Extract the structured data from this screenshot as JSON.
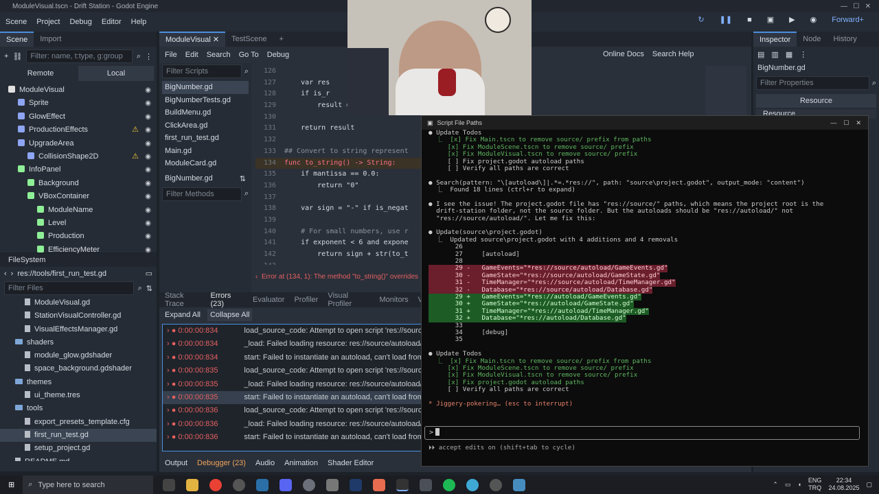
{
  "window_title": "ModuleVisual.tscn - Drift Station - Godot Engine",
  "menu": [
    "Scene",
    "Project",
    "Debug",
    "Editor",
    "Help"
  ],
  "renderer": "Forward+",
  "scene_panel": {
    "tabs": [
      "Scene",
      "Import"
    ],
    "filter_placeholder": "Filter: name, t:type, g:group",
    "remote": "Remote",
    "local": "Local",
    "nodes": [
      {
        "label": "ModuleVisual",
        "depth": 0,
        "color": "#e0e0e0",
        "warn": false
      },
      {
        "label": "Sprite",
        "depth": 1,
        "color": "#8da5f3",
        "warn": false
      },
      {
        "label": "GlowEffect",
        "depth": 1,
        "color": "#8da5f3",
        "warn": false
      },
      {
        "label": "ProductionEffects",
        "depth": 1,
        "color": "#8da5f3",
        "warn": true
      },
      {
        "label": "UpgradeArea",
        "depth": 1,
        "color": "#8da5f3",
        "warn": false
      },
      {
        "label": "CollisionShape2D",
        "depth": 2,
        "color": "#8da5f3",
        "warn": true
      },
      {
        "label": "InfoPanel",
        "depth": 1,
        "color": "#8eef97",
        "warn": false
      },
      {
        "label": "Background",
        "depth": 2,
        "color": "#8eef97",
        "warn": false
      },
      {
        "label": "VBoxContainer",
        "depth": 2,
        "color": "#8eef97",
        "warn": false
      },
      {
        "label": "ModuleName",
        "depth": 3,
        "color": "#8eef97",
        "warn": false
      },
      {
        "label": "Level",
        "depth": 3,
        "color": "#8eef97",
        "warn": false
      },
      {
        "label": "Production",
        "depth": 3,
        "color": "#8eef97",
        "warn": false
      },
      {
        "label": "EfficiencyMeter",
        "depth": 3,
        "color": "#8eef97",
        "warn": false
      }
    ]
  },
  "filesystem": {
    "title": "FileSystem",
    "path": "res://tools/first_run_test.gd",
    "filter_placeholder": "Filter Files",
    "items": [
      {
        "label": "ModuleVisual.gd",
        "depth": 2,
        "type": "file"
      },
      {
        "label": "StationVisualController.gd",
        "depth": 2,
        "type": "file"
      },
      {
        "label": "VisualEffectsManager.gd",
        "depth": 2,
        "type": "file"
      },
      {
        "label": "shaders",
        "depth": 1,
        "type": "folder"
      },
      {
        "label": "module_glow.gdshader",
        "depth": 2,
        "type": "file"
      },
      {
        "label": "space_background.gdshader",
        "depth": 2,
        "type": "file"
      },
      {
        "label": "themes",
        "depth": 1,
        "type": "folder"
      },
      {
        "label": "ui_theme.tres",
        "depth": 2,
        "type": "file"
      },
      {
        "label": "tools",
        "depth": 1,
        "type": "folder"
      },
      {
        "label": "export_presets_template.cfg",
        "depth": 2,
        "type": "file"
      },
      {
        "label": "first_run_test.gd",
        "depth": 2,
        "type": "file",
        "selected": true
      },
      {
        "label": "setup_project.gd",
        "depth": 2,
        "type": "file"
      },
      {
        "label": "README.md",
        "depth": 1,
        "type": "file"
      }
    ]
  },
  "editor_tabs": [
    "ModuleVisual",
    "TestScene"
  ],
  "script_menu": [
    "File",
    "Edit",
    "Search",
    "Go To",
    "Debug"
  ],
  "online_docs": "Online Docs",
  "search_help": "Search Help",
  "script_list": {
    "filter_placeholder": "Filter Scripts",
    "items": [
      "BigNumber.gd",
      "BigNumberTests.gd",
      "BuildMenu.gd",
      "ClickArea.gd",
      "first_run_test.gd",
      "Main.gd",
      "ModuleCard.gd"
    ],
    "current": "BigNumber.gd",
    "methods_placeholder": "Filter Methods"
  },
  "code": {
    "lines": [
      {
        "n": "126",
        "t": ""
      },
      {
        "n": "127",
        "t": "    var res"
      },
      {
        "n": "128",
        "t": "    if is_r"
      },
      {
        "n": "129",
        "t": "        result = -result"
      },
      {
        "n": "130",
        "t": ""
      },
      {
        "n": "131",
        "t": "    return result"
      },
      {
        "n": "132",
        "t": ""
      },
      {
        "n": "133",
        "t": "## Convert to string represent"
      },
      {
        "n": "134",
        "t": "func to_string() -> String:"
      },
      {
        "n": "135",
        "t": "    if mantissa == 0.0:"
      },
      {
        "n": "136",
        "t": "        return \"0\""
      },
      {
        "n": "137",
        "t": ""
      },
      {
        "n": "138",
        "t": "    var sign = \"-\" if is_negat"
      },
      {
        "n": "139",
        "t": ""
      },
      {
        "n": "140",
        "t": "    # For small numbers, use r"
      },
      {
        "n": "141",
        "t": "    if exponent < 6 and expone"
      },
      {
        "n": "142",
        "t": "        return sign + str(to_t"
      },
      {
        "n": "143",
        "t": ""
      }
    ],
    "error_line": "Error at (134, 1): The method \"to_string()\" overrides"
  },
  "debugger": {
    "tabs": [
      "Stack Trace",
      "Errors (23)",
      "Evaluator",
      "Profiler",
      "Visual Profiler",
      "Monitors",
      "V"
    ],
    "expand_all": "Expand All",
    "collapse_all": "Collapse All",
    "errors": [
      {
        "time": "0:00:00:834",
        "msg": "load_source_code: Attempt to open script 'res://source/autoloa"
      },
      {
        "time": "0:00:00:834",
        "msg": "_load: Failed loading resource: res://source/autoload/GameSta"
      },
      {
        "time": "0:00:00:834",
        "msg": "start: Failed to instantiate an autoload, can't load from path: re"
      },
      {
        "time": "0:00:00:835",
        "msg": "load_source_code: Attempt to open script 'res://source/autoloa"
      },
      {
        "time": "0:00:00:835",
        "msg": "_load: Failed loading resource: res://source/autoload/TimeMan"
      },
      {
        "time": "0:00:00:835",
        "msg": "start: Failed to instantiate an autoload, can't load from path: re"
      },
      {
        "time": "0:00:00:836",
        "msg": "load_source_code: Attempt to open script 'res://source/autoloa"
      },
      {
        "time": "0:00:00:836",
        "msg": "_load: Failed loading resource: res://source/autoload/Database"
      },
      {
        "time": "0:00:00:836",
        "msg": "start: Failed to instantiate an autoload, can't load from path: re"
      }
    ]
  },
  "bottom_tabs": [
    "Output",
    "Debugger (23)",
    "Audio",
    "Animation",
    "Shader Editor"
  ],
  "inspector": {
    "tabs": [
      "Inspector",
      "Node",
      "History"
    ],
    "object": "BigNumber.gd",
    "filter_placeholder": "Filter Properties",
    "resource": "Resource",
    "resource_sub": "Resource"
  },
  "terminal": {
    "title": "Script File Paths",
    "lines": [
      {
        "t": "● Update Todos",
        "c": "#cccccc"
      },
      {
        "t": "  ⎿  [x] Fix Main.tscn to remove source/ prefix from paths",
        "c": "#5fb760"
      },
      {
        "t": "     [x] Fix ModuleScene.tscn to remove source/ prefix",
        "c": "#5fb760"
      },
      {
        "t": "     [x] Fix ModuleVisual.tscn to remove source/ prefix",
        "c": "#5fb760"
      },
      {
        "t": "     [ ] Fix project.godot autoload paths",
        "c": "#cccccc"
      },
      {
        "t": "     [ ] Verify all paths are correct",
        "c": "#cccccc"
      },
      {
        "t": "",
        "c": "#cccccc"
      },
      {
        "t": "● Search(pattern: \"\\[autoload\\]|.*=.*res://\", path: \"source\\project.godot\", output_mode: \"content\")",
        "c": "#cccccc"
      },
      {
        "t": "  ⎿  Found 18 lines (ctrl+r to expand)",
        "c": "#cccccc"
      },
      {
        "t": "",
        "c": "#cccccc"
      },
      {
        "t": "● I see the issue! The project.godot file has \"res://source/\" paths, which means the project root is the",
        "c": "#cccccc"
      },
      {
        "t": "  drift-station folder, not the source folder. But the autoloads should be \"res://autoload/\" not",
        "c": "#cccccc"
      },
      {
        "t": "  \"res://source/autoload/\". Let me fix this:",
        "c": "#cccccc"
      },
      {
        "t": "",
        "c": "#cccccc"
      },
      {
        "t": "● Update(source\\project.godot)",
        "c": "#cccccc"
      },
      {
        "t": "  ⎿  Updated source\\project.godot with 4 additions and 4 removals",
        "c": "#cccccc"
      },
      {
        "t": "       26",
        "c": "#cccccc"
      },
      {
        "t": "       27     [autoload]",
        "c": "#cccccc"
      },
      {
        "t": "       28",
        "c": "#cccccc"
      },
      {
        "t": "       29 -   GameEvents=\"*res://source/autoload/GameEvents.gd\"",
        "c": "#ffd0d8",
        "bg": "del"
      },
      {
        "t": "       30 -   GameState=\"*res://source/autoload/GameState.gd\"",
        "c": "#ffd0d8",
        "bg": "del"
      },
      {
        "t": "       31 -   TimeManager=\"*res://source/autoload/TimeManager.gd\"",
        "c": "#ffd0d8",
        "bg": "del"
      },
      {
        "t": "       32 -   Database=\"*res://source/autoload/Database.gd\"",
        "c": "#ffd0d8",
        "bg": "del"
      },
      {
        "t": "       29 +   GameEvents=\"*res://autoload/GameEvents.gd\"",
        "c": "#d6ffd6",
        "bg": "add"
      },
      {
        "t": "       30 +   GameState=\"*res://autoload/GameState.gd\"",
        "c": "#d6ffd6",
        "bg": "add"
      },
      {
        "t": "       31 +   TimeManager=\"*res://autoload/TimeManager.gd\"",
        "c": "#d6ffd6",
        "bg": "add"
      },
      {
        "t": "       32 +   Database=\"*res://autoload/Database.gd\"",
        "c": "#d6ffd6",
        "bg": "add"
      },
      {
        "t": "       33",
        "c": "#cccccc"
      },
      {
        "t": "       34     [debug]",
        "c": "#cccccc"
      },
      {
        "t": "       35",
        "c": "#cccccc"
      },
      {
        "t": "",
        "c": "#cccccc"
      },
      {
        "t": "● Update Todos",
        "c": "#cccccc"
      },
      {
        "t": "  ⎿  [x] Fix Main.tscn to remove source/ prefix from paths",
        "c": "#5fb760"
      },
      {
        "t": "     [x] Fix ModuleScene.tscn to remove source/ prefix",
        "c": "#5fb760"
      },
      {
        "t": "     [x] Fix ModuleVisual.tscn to remove source/ prefix",
        "c": "#5fb760"
      },
      {
        "t": "     [x] Fix project.godot autoload paths",
        "c": "#5fb760"
      },
      {
        "t": "     [ ] Verify all paths are correct",
        "c": "#cccccc"
      },
      {
        "t": "",
        "c": "#cccccc"
      },
      {
        "t": "* Jiggery-pokering… (esc to interrupt)",
        "c": "#e8836b"
      }
    ],
    "prompt": ">",
    "hint": "⏵⏵ accept edits on (shift+tab to cycle)"
  },
  "taskbar": {
    "search_placeholder": "Type here to search",
    "lang": "ENG",
    "lang2": "TRQ",
    "time": "22:34",
    "date": "24.08.2025"
  },
  "colors": {
    "accent": "#4b8fde",
    "error": "#e56060",
    "warn": "#f2c43c"
  }
}
